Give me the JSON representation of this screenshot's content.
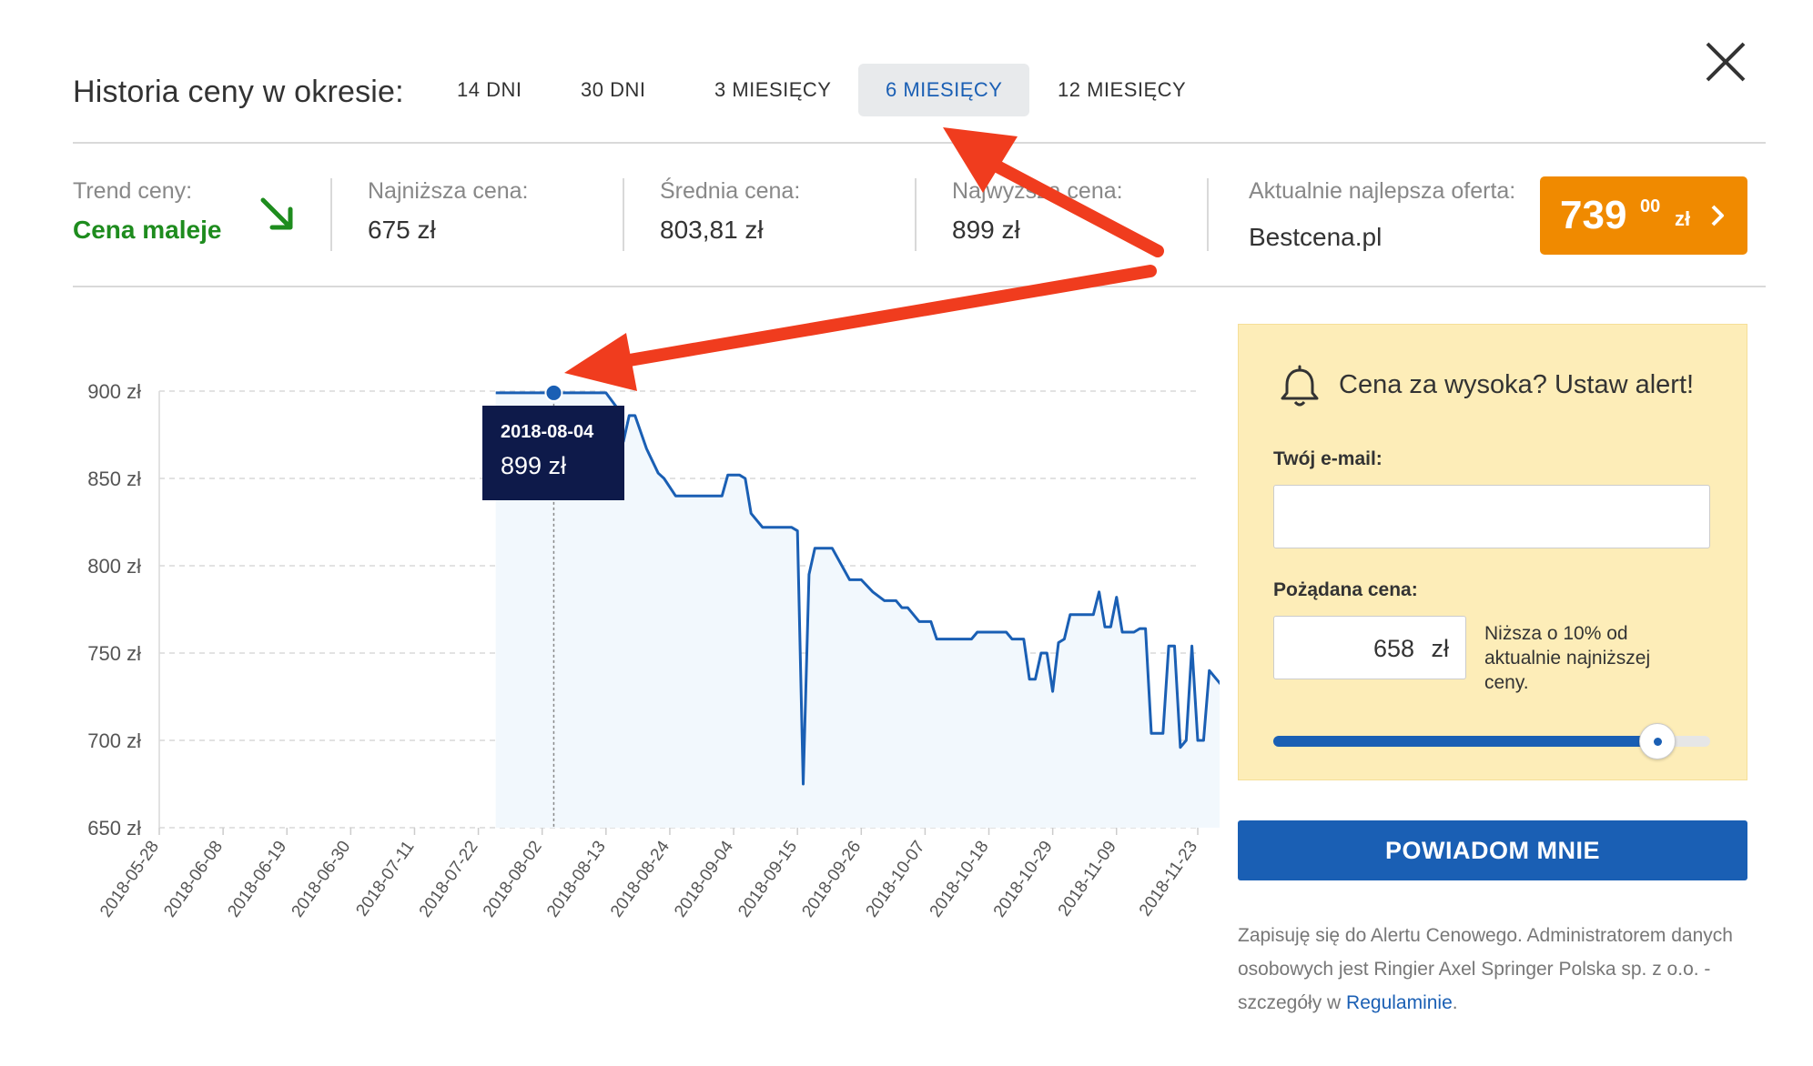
{
  "header": {
    "title": "Historia ceny w okresie:",
    "tabs": [
      {
        "label": "14 DNI",
        "active": false
      },
      {
        "label": "30 DNI",
        "active": false
      },
      {
        "label": "3 MIESIĘCY",
        "active": false
      },
      {
        "label": "6 MIESIĘCY",
        "active": true
      },
      {
        "label": "12 MIESIĘCY",
        "active": false
      }
    ],
    "close_icon": "close-icon"
  },
  "stats": {
    "trend": {
      "label": "Trend ceny:",
      "value": "Cena maleje",
      "icon": "trend-down-arrow-icon",
      "color": "#1e8c1e"
    },
    "lowest": {
      "label": "Najniższa cena:",
      "value": "675 zł"
    },
    "average": {
      "label": "Średnia cena:",
      "value": "803,81 zł"
    },
    "highest": {
      "label": "Najwyższa cena:",
      "value": "899 zł"
    },
    "best_offer": {
      "label": "Aktualnie najlepsza oferta:",
      "shop": "Bestcena.pl",
      "price_int": "739",
      "price_dec": "00",
      "currency": "zł",
      "color": "#f08a00"
    }
  },
  "chart_data": {
    "type": "area",
    "y_tick_labels": [
      "900 zł",
      "850 zł",
      "800 zł",
      "750 zł",
      "700 zł",
      "650 zł"
    ],
    "y_ticks": [
      900,
      850,
      800,
      750,
      700,
      650
    ],
    "ylim": [
      650,
      900
    ],
    "x_tick_labels": [
      "2018-05-28",
      "2018-06-08",
      "2018-06-19",
      "2018-06-30",
      "2018-07-11",
      "2018-07-22",
      "2018-08-02",
      "2018-08-13",
      "2018-08-24",
      "2018-09-04",
      "2018-09-15",
      "2018-09-26",
      "2018-10-07",
      "2018-10-18",
      "2018-10-29",
      "2018-11-09",
      "2018-11-23"
    ],
    "x_range": [
      "2018-05-28",
      "2018-11-23"
    ],
    "grid": true,
    "line_color": "#1a5fb4",
    "series": [
      {
        "points": [
          [
            "2018-07-25",
            899
          ],
          [
            "2018-08-04",
            899
          ],
          [
            "2018-08-13",
            899
          ],
          [
            "2018-08-15",
            890
          ],
          [
            "2018-08-16",
            871
          ],
          [
            "2018-08-17",
            886
          ],
          [
            "2018-08-18",
            886
          ],
          [
            "2018-08-20",
            867
          ],
          [
            "2018-08-21",
            860
          ],
          [
            "2018-08-22",
            853
          ],
          [
            "2018-08-23",
            850
          ],
          [
            "2018-08-25",
            840
          ],
          [
            "2018-08-26",
            840
          ],
          [
            "2018-09-02",
            840
          ],
          [
            "2018-09-03",
            852
          ],
          [
            "2018-09-05",
            852
          ],
          [
            "2018-09-06",
            850
          ],
          [
            "2018-09-07",
            830
          ],
          [
            "2018-09-09",
            822
          ],
          [
            "2018-09-14",
            822
          ],
          [
            "2018-09-15",
            820
          ],
          [
            "2018-09-16",
            675
          ],
          [
            "2018-09-17",
            795
          ],
          [
            "2018-09-18",
            810
          ],
          [
            "2018-09-20",
            810
          ],
          [
            "2018-09-21",
            810
          ],
          [
            "2018-09-24",
            792
          ],
          [
            "2018-09-26",
            792
          ],
          [
            "2018-09-28",
            785
          ],
          [
            "2018-09-30",
            780
          ],
          [
            "2018-10-02",
            780
          ],
          [
            "2018-10-03",
            776
          ],
          [
            "2018-10-04",
            776
          ],
          [
            "2018-10-06",
            768
          ],
          [
            "2018-10-08",
            768
          ],
          [
            "2018-10-09",
            758
          ],
          [
            "2018-10-15",
            758
          ],
          [
            "2018-10-16",
            762
          ],
          [
            "2018-10-21",
            762
          ],
          [
            "2018-10-22",
            758
          ],
          [
            "2018-10-24",
            758
          ],
          [
            "2018-10-25",
            735
          ],
          [
            "2018-10-26",
            735
          ],
          [
            "2018-10-27",
            750
          ],
          [
            "2018-10-28",
            750
          ],
          [
            "2018-10-29",
            728
          ],
          [
            "2018-10-30",
            756
          ],
          [
            "2018-10-31",
            758
          ],
          [
            "2018-11-01",
            772
          ],
          [
            "2018-11-05",
            772
          ],
          [
            "2018-11-06",
            785
          ],
          [
            "2018-11-07",
            765
          ],
          [
            "2018-11-08",
            765
          ],
          [
            "2018-11-09",
            782
          ],
          [
            "2018-11-10",
            762
          ],
          [
            "2018-11-12",
            762
          ],
          [
            "2018-11-13",
            764
          ],
          [
            "2018-11-14",
            764
          ],
          [
            "2018-11-15",
            704
          ],
          [
            "2018-11-17",
            704
          ],
          [
            "2018-11-18",
            754
          ],
          [
            "2018-11-19",
            754
          ],
          [
            "2018-11-20",
            696
          ],
          [
            "2018-11-21",
            700
          ],
          [
            "2018-11-22",
            754
          ],
          [
            "2018-11-23",
            700
          ],
          [
            "2018-11-24",
            700
          ],
          [
            "2018-11-25",
            740
          ],
          [
            "2018-11-26",
            736
          ],
          [
            "2018-11-27",
            732
          ]
        ]
      }
    ],
    "tooltip": {
      "date": "2018-08-04",
      "value": "899 zł",
      "point": [
        "2018-08-04",
        899
      ]
    }
  },
  "alert": {
    "title": "Cena za wysoka? Ustaw alert!",
    "bell_icon": "bell-icon",
    "email_label": "Twój e-mail:",
    "email_value": "",
    "price_label": "Pożądana cena:",
    "price_value": "658",
    "price_currency": "zł",
    "price_note": "Niższa o 10% od aktualnie najniższej ceny.",
    "slider_level": 0.88
  },
  "notify_button": "POWIADOM MNIE",
  "disclaimer": {
    "text": "Zapisuję się do Alertu Cenowego. Administratorem danych osobowych jest Ringier Axel Springer Polska sp. z o.o. - szczegóły w ",
    "link": "Regulaminie",
    "end": "."
  }
}
